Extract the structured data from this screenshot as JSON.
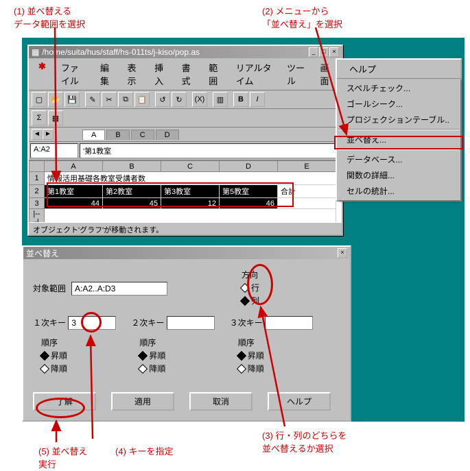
{
  "annotations": {
    "a1_l1": "(1) 並べ替える",
    "a1_l2": "データ範囲を選択",
    "a2_l1": "(2) メニューから",
    "a2_l2": "「並べ替え」を選択",
    "a3_l1": "(3) 行・列のどちらを",
    "a3_l2": "並べ替えるか選択",
    "a4": "(4) キーを指定",
    "a5_l1": "(5) 並べ替え",
    "a5_l2": "実行"
  },
  "main_window": {
    "title": "/home/suita/hus/staff/hs-011ts/j-kiso/pop.as",
    "menubar": [
      "ファイル",
      "編集",
      "表示",
      "挿入",
      "書式",
      "範囲",
      "リアルタイム",
      "ツール",
      "画面",
      "ヘルプ"
    ],
    "sheet_tabs": [
      "A",
      "B",
      "C",
      "D"
    ],
    "cell_ref": "A:A2",
    "cell_content": "'第1教室",
    "col_headers": [
      "A",
      "B",
      "C",
      "D",
      "E"
    ],
    "rows": [
      {
        "h": "1",
        "cells": [
          "情報活用基礎各教室受講者数",
          "",
          "",
          "",
          ""
        ]
      },
      {
        "h": "2",
        "cells": [
          "第1教室",
          "第2教室",
          "第3教室",
          "第5教室",
          "合計"
        ]
      },
      {
        "h": "3",
        "cells": [
          "44",
          "45",
          "12",
          "46",
          ""
        ]
      }
    ],
    "status": "オブジェクト'グラフ'が移動されます。"
  },
  "dropdown": {
    "items": [
      "スペルチェック...",
      "ゴールシーク...",
      "プロジェクションテーブル..",
      "並べ替え...",
      "データベース...",
      "関数の詳細...",
      "セルの統計..."
    ]
  },
  "dialog": {
    "title": "並べ替え",
    "range_label": "対象範囲",
    "range_value": "A:A2..A:D3",
    "direction_label": "方向",
    "direction_row": "行",
    "direction_col": "列",
    "key1_label": "１次キー",
    "key1_value": "3",
    "key2_label": "２次キー",
    "key2_value": "",
    "key3_label": "３次キー",
    "key3_value": "",
    "order_label": "順序",
    "asc": "昇順",
    "desc": "降順",
    "ok": "了解",
    "apply": "適用",
    "cancel": "取消",
    "help": "ヘルプ"
  }
}
